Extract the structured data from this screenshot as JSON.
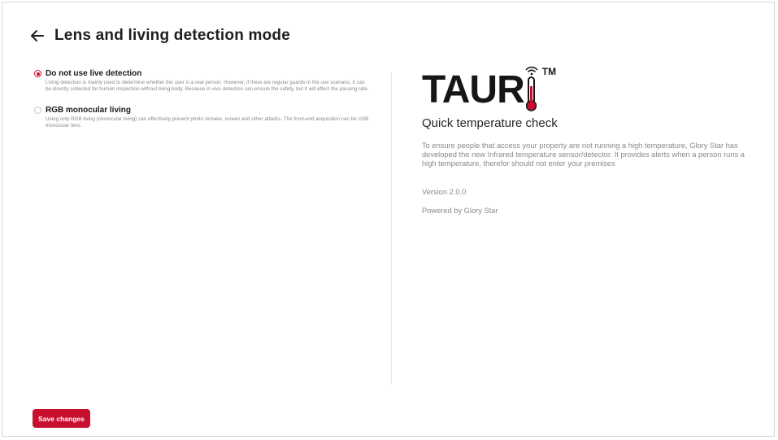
{
  "header": {
    "title": "Lens and living detection mode",
    "back_icon": "arrow-left-icon"
  },
  "options": [
    {
      "label": "Do not use live detection",
      "description": "Living detection is mainly used to determine whether the user is a real person. However, if there are regular guards in the use scenario, it can be directly collected for human inspection without living body. Because in vivo detection can ensure the safety, but it will affect the passing rate.",
      "selected": true
    },
    {
      "label": "RGB monocular living",
      "description": "Using only RGB living (monocular living) can effectively prevent photo remake, screen and other attacks. The front-end acquisition can be USB monocular lens.",
      "selected": false
    }
  ],
  "brand": {
    "logo_text": "TAUR",
    "trademark": "TM",
    "tagline": "Quick temperature check",
    "description": "To ensure people that access your property are not running a high temperature, Glory Star has developed the new Infrared temperature sensor/detector. It provides alerts when a person runs a high temperature, therefor should not enter your premises",
    "version": "Version 2.0.0",
    "powered_by": "Powered by Glory Star"
  },
  "actions": {
    "save_label": "Save changes"
  },
  "colors": {
    "accent": "#c8102e",
    "muted_text": "#8a8a8a"
  }
}
